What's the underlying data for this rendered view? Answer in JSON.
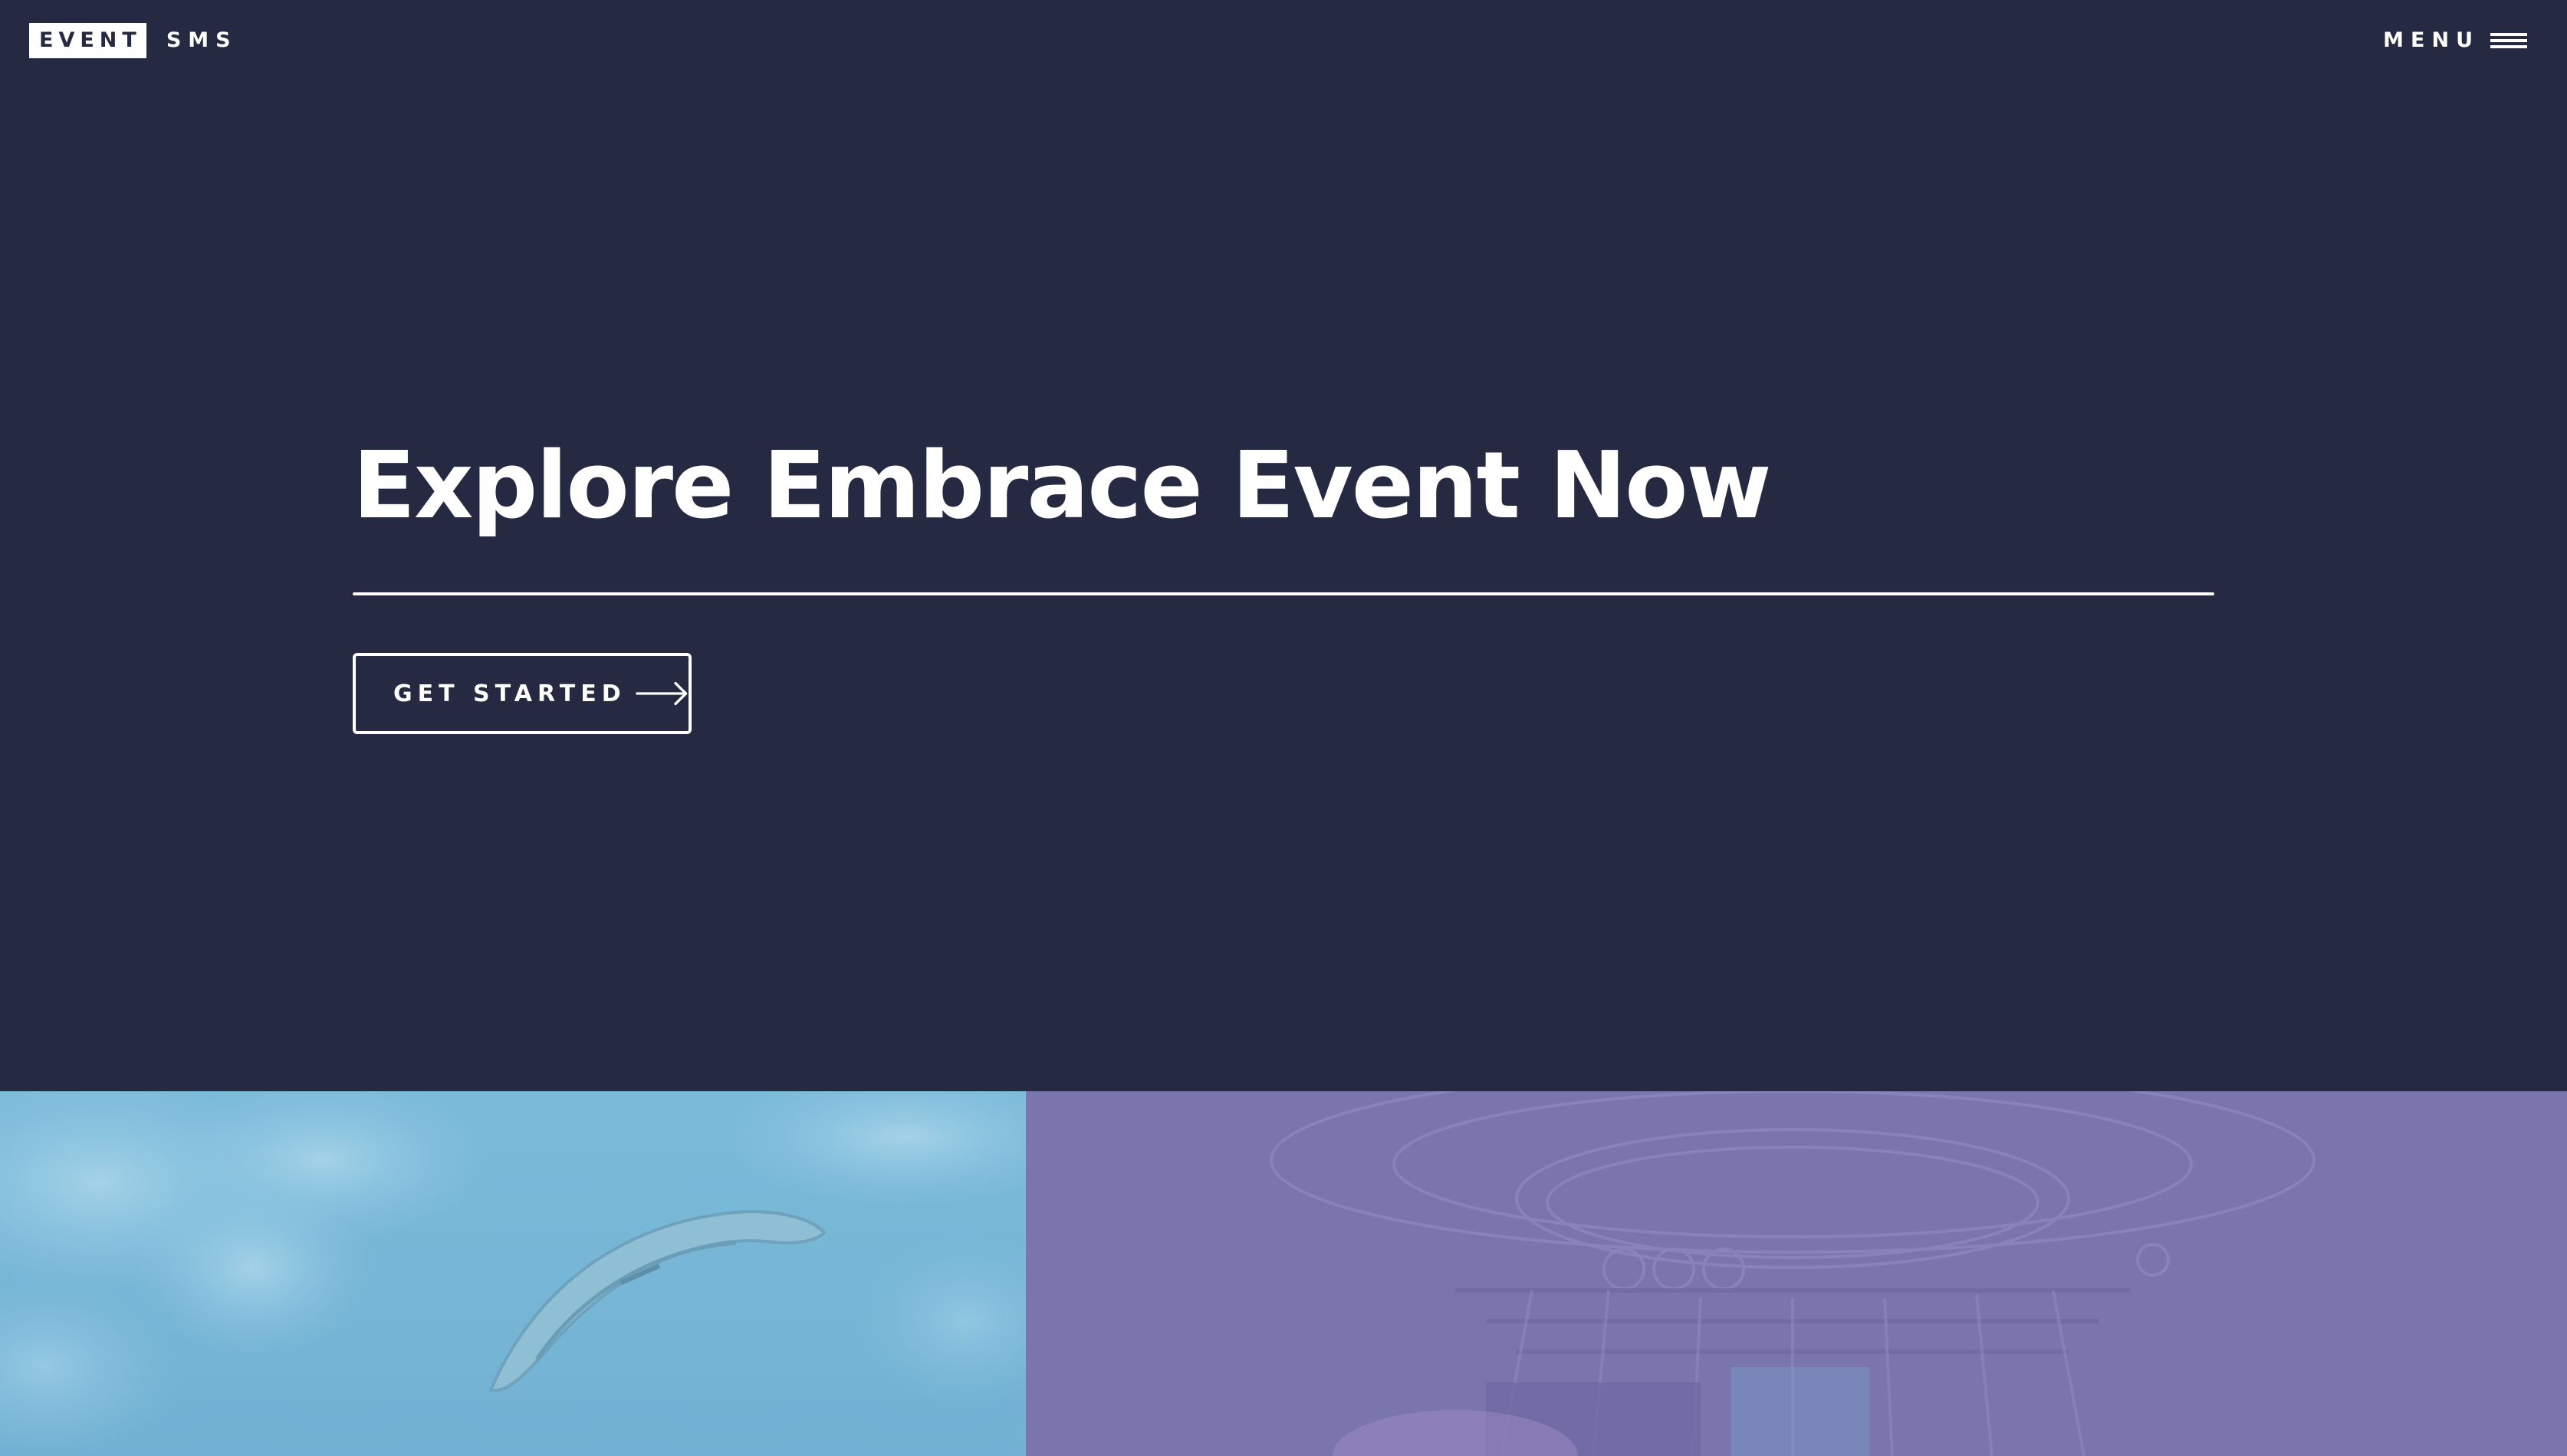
{
  "header": {
    "logo_box_text": "EVENT",
    "logo_text": "SMS",
    "menu_label": "MENU",
    "menu_icon": "hamburger-icon"
  },
  "hero": {
    "title": "Explore Embrace Event Now",
    "cta_label": "GET STARTED",
    "cta_icon": "arrow-right-icon"
  },
  "panels": {
    "left": {
      "subject": "paraglider in a cloudy sky",
      "tint": "#76b6d6"
    },
    "right": {
      "subject": "concert stage with lighting rig",
      "tint": "#7a76ad"
    }
  },
  "colors": {
    "background": "#252a42",
    "foreground": "#ffffff"
  }
}
